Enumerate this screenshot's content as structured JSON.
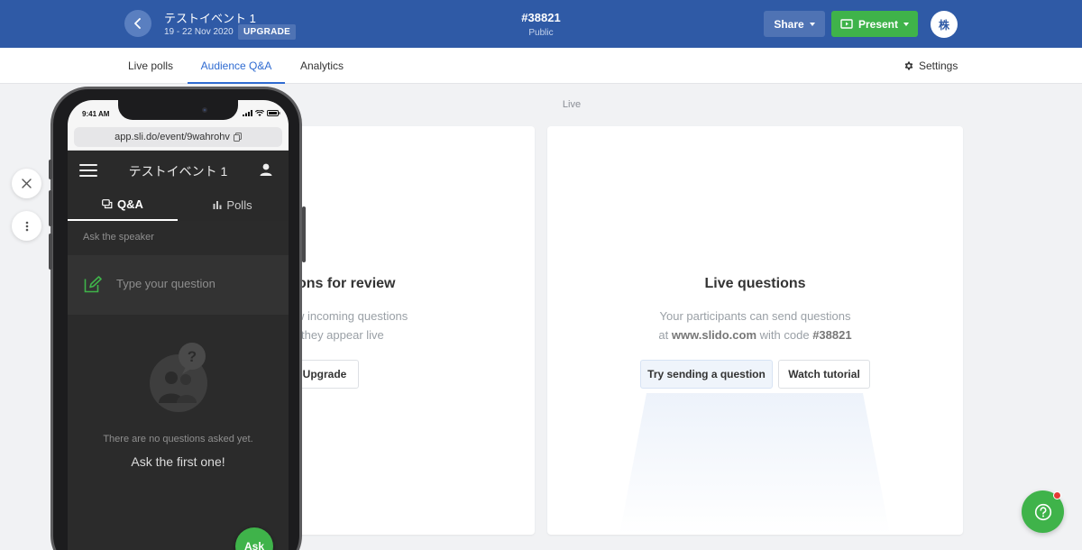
{
  "header": {
    "event_title": "テストイベント 1",
    "event_dates": "19 - 22 Nov 2020",
    "upgrade_label": "UPGRADE",
    "event_code": "#38821",
    "visibility": "Public",
    "share_label": "Share",
    "present_label": "Present",
    "avatar_initial": "株"
  },
  "tabs": [
    {
      "label": "Live polls"
    },
    {
      "label": "Audience Q&A"
    },
    {
      "label": "Analytics"
    }
  ],
  "settings_label": "Settings",
  "live_column_label": "Live",
  "review_card": {
    "title": "ons for review",
    "desc_line1": "w incoming questions",
    "desc_line2": "they appear live",
    "upgrade_btn": "Upgrade"
  },
  "live_card": {
    "title": "Live questions",
    "desc_line1": "Your participants can send questions",
    "desc_at": "at",
    "desc_url": "www.slido.com",
    "desc_with": "with code",
    "desc_code": "#38821",
    "try_btn": "Try sending a question",
    "watch_btn": "Watch tutorial"
  },
  "phone": {
    "time": "9:41 AM",
    "url": "app.sli.do/event/9wahrohv",
    "app_title": "テストイベント 1",
    "tab_qa": "Q&A",
    "tab_polls": "Polls",
    "ask_label": "Ask the speaker",
    "question_placeholder": "Type your question",
    "empty_line1": "There are no questions asked yet.",
    "empty_line2": "Ask the first one!",
    "ask_btn": "Ask"
  },
  "colors": {
    "header_bg": "#2f5aa6",
    "accent_blue": "#2f6bd1",
    "present_green": "#3fb34a"
  }
}
